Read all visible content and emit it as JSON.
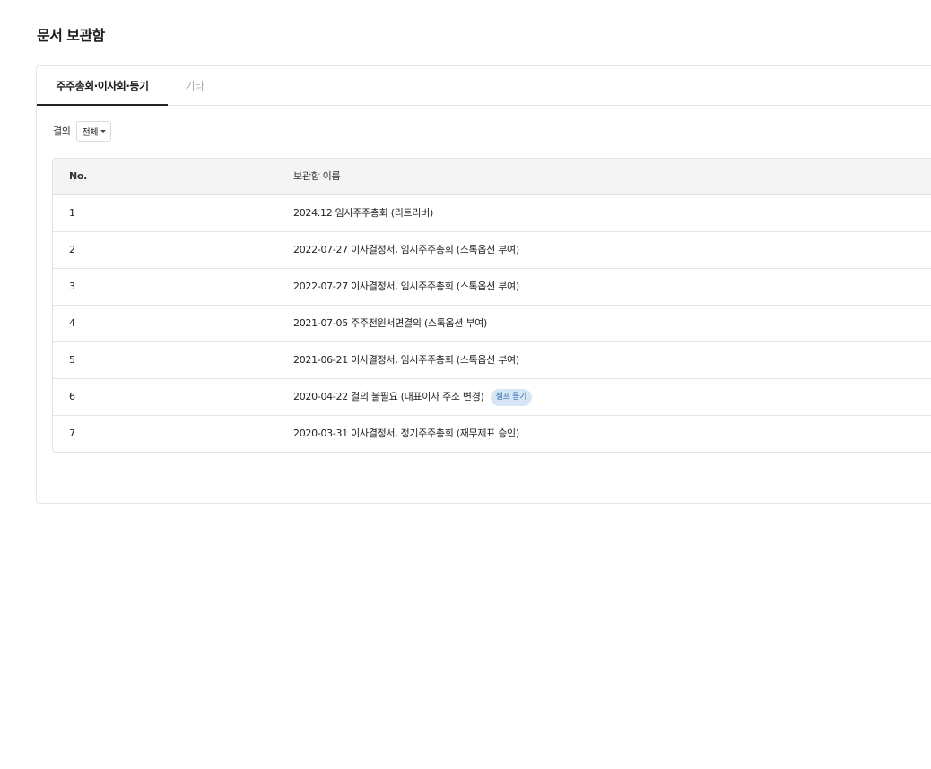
{
  "page": {
    "title": "문서 보관함"
  },
  "tabs": [
    {
      "label": "주주총회·이사회·등기",
      "active": true
    },
    {
      "label": "기타",
      "active": false
    }
  ],
  "filter": {
    "label": "결의",
    "selected": "전체"
  },
  "table": {
    "columns": [
      "No.",
      "보관함 이름"
    ],
    "rows": [
      {
        "no": "1",
        "name": "2024.12 임시주주총회 (리트리버)",
        "badge": ""
      },
      {
        "no": "2",
        "name": "2022-07-27 이사결정서, 임시주주총회 (스톡옵션 부여)",
        "badge": ""
      },
      {
        "no": "3",
        "name": "2022-07-27 이사결정서, 임시주주총회 (스톡옵션 부여)",
        "badge": ""
      },
      {
        "no": "4",
        "name": "2021-07-05 주주전원서면결의 (스톡옵션 부여)",
        "badge": ""
      },
      {
        "no": "5",
        "name": "2021-06-21 이사결정서, 임시주주총회 (스톡옵션 부여)",
        "badge": ""
      },
      {
        "no": "6",
        "name": "2020-04-22 결의 불필요 (대표이사 주소 변경)",
        "badge": "셀프 등기"
      },
      {
        "no": "7",
        "name": "2020-03-31 이사결정서, 정기주주총회 (재무제표 승인)",
        "badge": ""
      }
    ]
  },
  "colors": {
    "active_tab_underline": "#222222",
    "inactive_tab_text": "#a9a9a9",
    "table_header_bg": "#f4f4f4",
    "badge_bg": "#d6e6f5",
    "badge_text": "#2a6eb3"
  }
}
